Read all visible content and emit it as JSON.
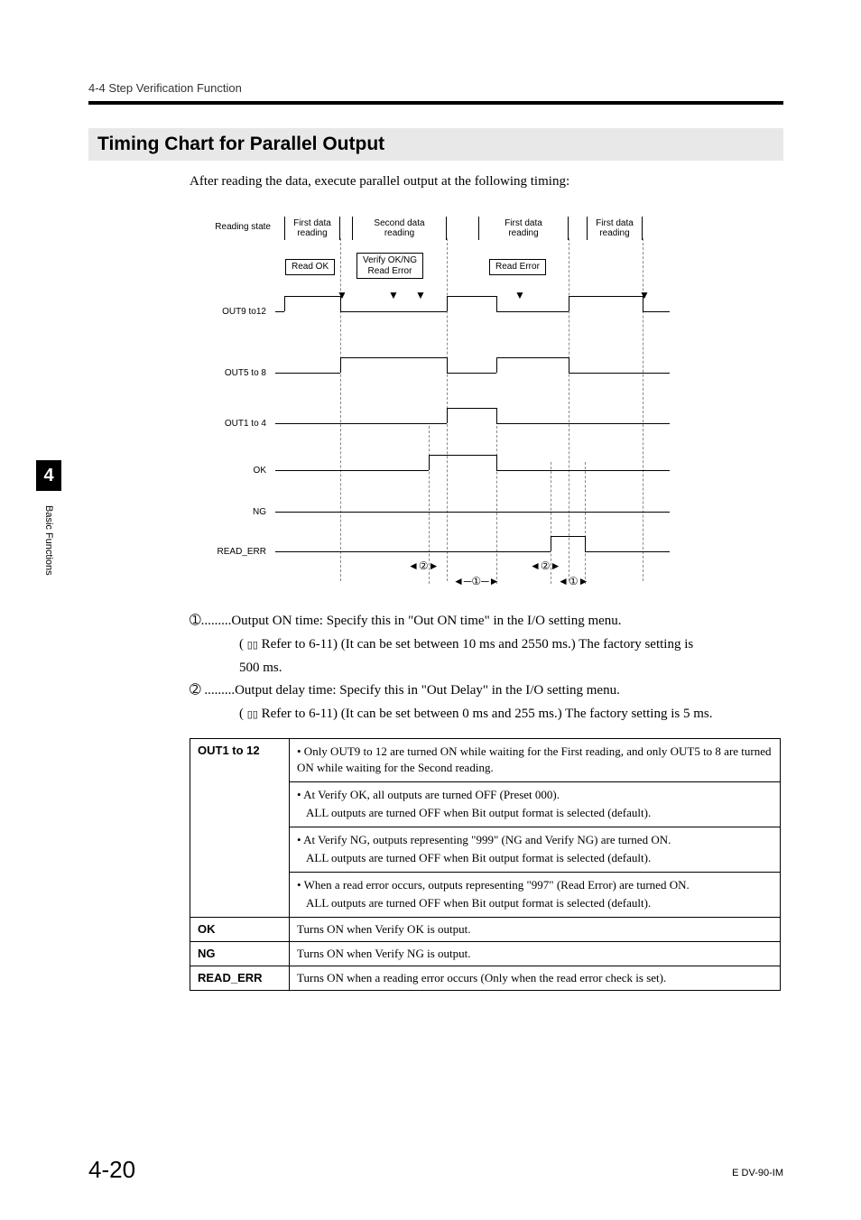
{
  "header": {
    "breadcrumb": "4-4  Step Verification Function"
  },
  "section": {
    "title": "Timing Chart for Parallel Output"
  },
  "intro": "After reading the data, execute parallel output at the following timing:",
  "chart": {
    "row_label": "Reading state",
    "cols": {
      "c1": "First data\nreading",
      "c2": "Second data\nreading",
      "c3": "First data\nreading",
      "c4": "First data\nreading"
    },
    "tags": {
      "read_ok": "Read OK",
      "verify": "Verify OK/NG\nRead Error",
      "read_error": "Read Error"
    },
    "signals": {
      "out9": "OUT9 to12",
      "out5": "OUT5 to 8",
      "out1": "OUT1 to 4",
      "ok": "OK",
      "ng": "NG",
      "read_err": "READ_ERR"
    },
    "markers": {
      "one": "①",
      "two": "②"
    }
  },
  "notes": {
    "n1a": "➀.........Output ON time: Specify this in \"Out ON time\" in the I/O setting menu.",
    "n1b": "Refer to 6-11) (It can be set between 10 ms and 2550 ms.) The factory setting is",
    "n1c": "500 ms.",
    "n2a": "➁ .........Output delay time: Specify this in \"Out Delay\" in the I/O setting menu.",
    "n2b": "Refer to 6-11) (It can be set between 0 ms and 255 ms.) The factory setting is 5 ms.",
    "paren_icon": "( "
  },
  "table": {
    "r1h": "OUT1 to 12",
    "r1a": "• Only OUT9 to 12 are turned ON while waiting for the First reading, and only OUT5 to 8 are turned ON while waiting for the Second reading.",
    "r1b1": "• At Verify OK, all outputs are turned OFF (Preset 000).",
    "r1b2": "ALL outputs are turned OFF when Bit output format is selected (default).",
    "r1c1": "• At Verify NG, outputs representing \"999\" (NG and Verify NG) are turned ON.",
    "r1c2": "ALL outputs are turned OFF when Bit output format is selected (default).",
    "r1d1": "• When a read error occurs, outputs representing \"997\" (Read Error) are turned ON.",
    "r1d2": "ALL outputs are turned OFF when Bit output format is selected (default).",
    "r2h": "OK",
    "r2": "Turns ON when Verify OK is output.",
    "r3h": "NG",
    "r3": "Turns ON when Verify NG is output.",
    "r4h": "READ_ERR",
    "r4": "Turns ON when a reading error occurs (Only when the read error check is set)."
  },
  "sidebar": {
    "num": "4",
    "caption": "Basic Functions"
  },
  "footer": {
    "left": "4-20",
    "right": "E DV-90-IM"
  },
  "icons": {
    "book": "▯▯"
  }
}
